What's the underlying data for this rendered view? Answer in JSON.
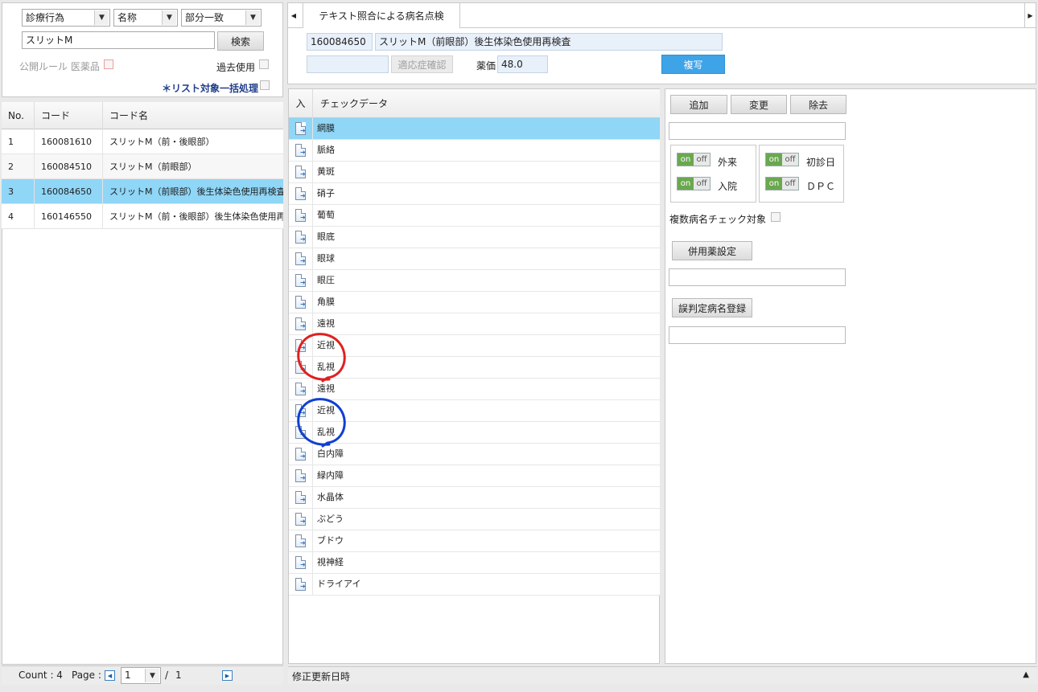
{
  "search": {
    "category_select": "診療行為",
    "field_select": "名称",
    "match_select": "部分一致",
    "query": "スリットM",
    "search_button": "検索",
    "public_rule_label": "公開ルール 医薬品",
    "past_use_label": "過去使用",
    "bulk_label": "＊リスト対象一括処理"
  },
  "code_table": {
    "headers": [
      "No.",
      "コード",
      "コード名"
    ],
    "rows": [
      {
        "no": "1",
        "code": "160081610",
        "name": "スリットM（前・後眼部）"
      },
      {
        "no": "2",
        "code": "160084510",
        "name": "スリットM（前眼部）"
      },
      {
        "no": "3",
        "code": "160084650",
        "name": "スリットM（前眼部）後生体染色使用再検査"
      },
      {
        "no": "4",
        "code": "160146550",
        "name": "スリットM（前・後眼部）後生体染色使用再検査"
      }
    ],
    "selected_index": 2
  },
  "footer": {
    "count_label": "Count : 4",
    "page_label": "Page :",
    "page_value": "1",
    "page_sep": "/",
    "page_total": "1"
  },
  "tab": {
    "title": "テキスト照合による病名点検"
  },
  "info": {
    "code": "160084650",
    "name": "スリットM（前眼部）後生体染色使用再検査",
    "indication_button": "適応症確認",
    "price_label": "薬価",
    "price_value": "48.0",
    "copy_button": "複写"
  },
  "check_table": {
    "headers": [
      "入",
      "チェックデータ"
    ],
    "rows": [
      "網膜",
      "脈絡",
      "黄斑",
      "硝子",
      "葡萄",
      "眼底",
      "眼球",
      "眼圧",
      "角膜",
      "遠視",
      "近視",
      "乱視",
      "遠視",
      "近視",
      "乱視",
      "白内障",
      "緑内障",
      "水晶体",
      "ぶどう",
      "ブドウ",
      "視神経",
      "ドライアイ"
    ],
    "selected_index": 0,
    "annotations": [
      {
        "color": "#e02020",
        "rows": [
          10,
          11
        ]
      },
      {
        "color": "#1040d0",
        "rows": [
          13,
          14
        ]
      }
    ]
  },
  "right_panel": {
    "add_button": "追加",
    "change_button": "変更",
    "remove_button": "除去",
    "toggle_on": "on",
    "toggle_off": "off",
    "outpatient_label": "外来",
    "inpatient_label": "入院",
    "first_visit_label": "初診日",
    "dpc_label": "ＤＰＣ",
    "multi_check_label": "複数病名チェック対象",
    "concomitant_button": "併用薬設定",
    "misdiagnosis_button": "誤判定病名登録"
  },
  "status": {
    "updated_label": "修正更新日時"
  }
}
